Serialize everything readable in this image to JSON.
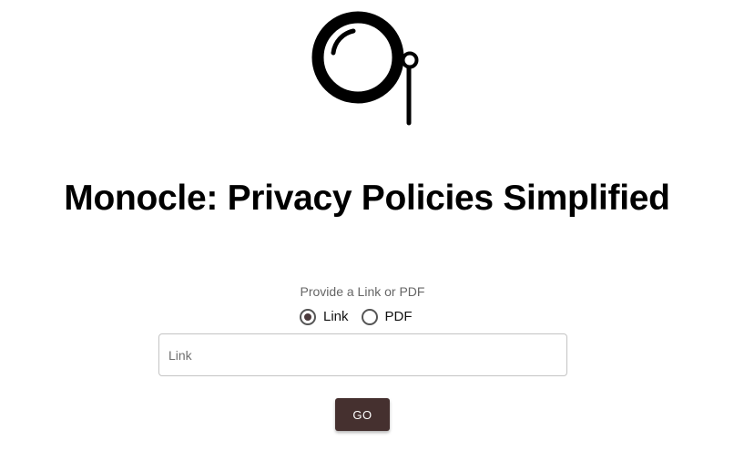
{
  "logo": {
    "icon": "monocle-icon"
  },
  "header": {
    "title": "Monocle: Privacy Policies Simplified"
  },
  "form": {
    "source_label": "Provide a Link or PDF",
    "options": [
      {
        "label": "Link",
        "checked": true
      },
      {
        "label": "PDF",
        "checked": false
      }
    ],
    "input_placeholder": "Link",
    "input_value": "",
    "submit_label": "GO"
  },
  "colors": {
    "button_background": "#45302f",
    "radio_checked": "#4b3a3c"
  }
}
